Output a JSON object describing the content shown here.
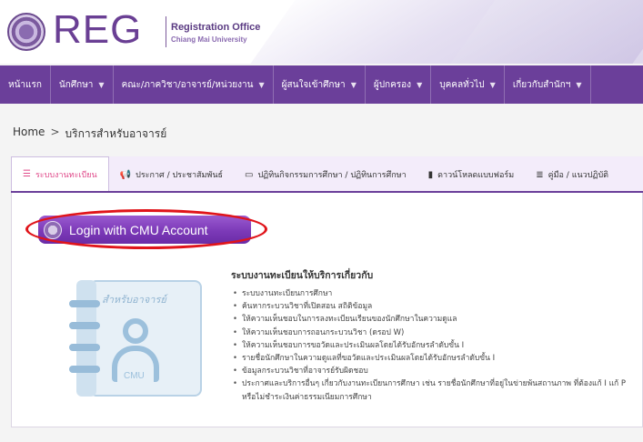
{
  "header": {
    "logo_text": "REG",
    "logo_line1": "Registration Office",
    "logo_line2": "Chiang Mai University"
  },
  "nav": {
    "items": [
      {
        "label": "หน้าแรก",
        "dropdown": false
      },
      {
        "label": "นักศึกษา",
        "dropdown": true
      },
      {
        "label": "คณะ/ภาควิชา/อาจารย์/หน่วยงาน",
        "dropdown": true
      },
      {
        "label": "ผู้สนใจเข้าศึกษา",
        "dropdown": true
      },
      {
        "label": "ผู้ปกครอง",
        "dropdown": true
      },
      {
        "label": "บุคคลทั่วไป",
        "dropdown": true
      },
      {
        "label": "เกี่ยวกับสำนักฯ",
        "dropdown": true
      }
    ]
  },
  "breadcrumb": {
    "home": "Home",
    "separator": ">",
    "current": "บริการสำหรับอาจารย์"
  },
  "tabs": [
    {
      "label": "ระบบงานทะเบียน",
      "icon": "database-icon",
      "active": true
    },
    {
      "label": "ประกาศ / ประชาสัมพันธ์",
      "icon": "megaphone-icon",
      "active": false
    },
    {
      "label": "ปฏิทินกิจกรรมการศึกษา / ปฏิทินการศึกษา",
      "icon": "calendar-icon",
      "active": false
    },
    {
      "label": "ดาวน์โหลดแบบฟอร์ม",
      "icon": "document-icon",
      "active": false
    },
    {
      "label": "คู่มือ / แนวปฏิบัติ",
      "icon": "list-icon",
      "active": false
    }
  ],
  "login": {
    "label": "Login with CMU Account"
  },
  "illustration": {
    "title": "สำหรับอาจารย์",
    "badge": "CMU"
  },
  "info": {
    "heading": "ระบบงานทะเบียนให้บริการเกี่ยวกับ",
    "items": [
      "ระบบงานทะเบียนการศึกษา",
      "ค้นหากระบวนวิชาที่เปิดสอน สถิติข้อมูล",
      "ให้ความเห็นชอบในการลงทะเบียนเรียนของนักศึกษาในความดูแล",
      "ให้ความเห็นชอบการถอนกระบวนวิชา (ดรอป W)",
      "ให้ความเห็นชอบการขอวัดและประเมินผลโดยได้รับอักษรลำดับขั้น I",
      "รายชื่อนักศึกษาในความดูแลที่ขอวัดและประเมินผลโดยได้รับอักษรลำดับขั้น I",
      "ข้อมูลกระบวนวิชาที่อาจารย์รับผิดชอบ",
      "ประกาศและบริการอื่นๆ เกี่ยวกับงานทะเบียนการศึกษา เช่น รายชื่อนักศึกษาที่อยู่ในข่ายพ้นสถานภาพ ที่ต้องแก้ I แก้ P หรือไม่ชำระเงินค่าธรรมเนียมการศึกษา"
    ]
  },
  "colors": {
    "nav_bg": "#6b3f9a",
    "active_tab_text": "#e04a8a",
    "login_button": "#7c3ab8",
    "highlight_oval": "#e0141a"
  }
}
